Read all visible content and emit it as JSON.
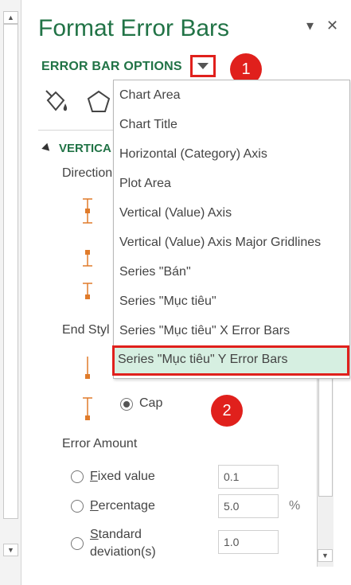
{
  "pane": {
    "title": "Format Error Bars",
    "dropdown_arrow_icon": "chevron-down-icon",
    "close_symbol": "✕",
    "pin_symbol": "▾"
  },
  "options": {
    "label": "ERROR BAR OPTIONS",
    "badge_1": "1",
    "badge_2": "2",
    "badge_color": "#e0201c",
    "accent_color": "#217346"
  },
  "tools": [
    "fill-line-icon",
    "effects-icon"
  ],
  "section": {
    "title": "VERTICAL ERROR BAR",
    "title_visible": "VERTICA"
  },
  "direction": {
    "label": "Direction"
  },
  "end_style": {
    "label": "End Style",
    "label_visible": "End Styl",
    "cap_label": "Cap",
    "cap_selected": true
  },
  "dropdown": {
    "items": [
      "Chart Area",
      "Chart Title",
      "Horizontal (Category) Axis",
      "Plot Area",
      "Vertical (Value) Axis",
      "Vertical (Value) Axis Major Gridlines",
      "Series \"Bán\"",
      "Series \"Mục tiêu\"",
      "Series \"Mục tiêu\" X Error Bars",
      "Series \"Mục tiêu\" Y Error Bars"
    ],
    "selected_index": 9
  },
  "error_amount": {
    "label": "Error Amount",
    "fixed": {
      "label_first": "F",
      "label_rest": "ixed value",
      "value": "0.1"
    },
    "percentage": {
      "label_first": "P",
      "label_rest": "ercentage",
      "value": "5.0",
      "unit": "%"
    },
    "stddev": {
      "label_line1_first": "S",
      "label_line1_rest": "tandard",
      "label_line2": "deviation(s)",
      "value": "1.0"
    }
  }
}
